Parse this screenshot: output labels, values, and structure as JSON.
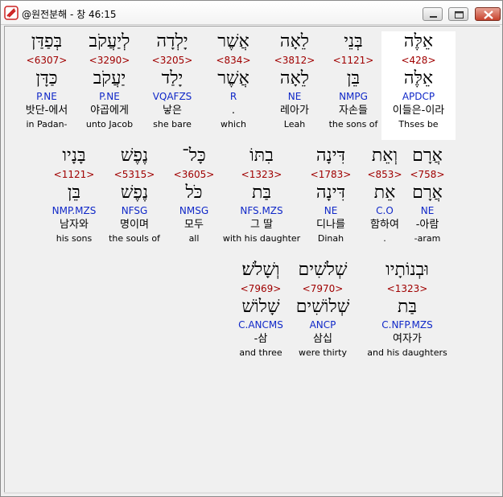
{
  "window": {
    "title": "@원전분해 - 창 46:15"
  },
  "rows": [
    {
      "words": [
        {
          "heb_pointed": "אֵלֶּה",
          "strong": "<428>",
          "lex": "אֵלֶּה",
          "parse": "APDCP",
          "korean": "이들은-이라",
          "english": "Thses be",
          "highlight": true
        },
        {
          "heb_pointed": "בְּנֵי",
          "strong": "<1121>",
          "lex": "בֵּן",
          "parse": "NMPG",
          "korean": "자손들",
          "english": "the sons of"
        },
        {
          "heb_pointed": "לֵאָה",
          "strong": "<3812>",
          "lex": "לֵאָה",
          "parse": "NE",
          "korean": "레아가",
          "english": "Leah"
        },
        {
          "heb_pointed": "אֲשֶׁר",
          "strong": "<834>",
          "lex": "אֲשֶׁר",
          "parse": "R",
          "korean": ".",
          "english": "which"
        },
        {
          "heb_pointed": "יָלְדָה",
          "strong": "<3205>",
          "lex": "יָלַד",
          "parse": "VQAFZS",
          "korean": "낳은",
          "english": "she bare"
        },
        {
          "heb_pointed": "לְיַעֲקֹב",
          "strong": "<3290>",
          "lex": "יַעֲקֹב",
          "parse": "P.NE",
          "korean": "야곱에게",
          "english": "unto Jacob"
        },
        {
          "heb_pointed": "בְּפַדַּן",
          "strong": "<6307>",
          "lex": "כַּדָּן",
          "parse": "P.NE",
          "korean": "밧단-에서",
          "english": "in Padan-"
        }
      ]
    },
    {
      "words": [
        {
          "heb_pointed": "אֲרָם",
          "strong": "<758>",
          "lex": "אֲרָם",
          "parse": "NE",
          "korean": "-아람",
          "english": "-aram"
        },
        {
          "heb_pointed": "וְאֵת",
          "strong": "<853>",
          "lex": "אֵת",
          "parse": "C.O",
          "korean": "함하여",
          "english": "."
        },
        {
          "heb_pointed": "דִּינָה",
          "strong": "<1783>",
          "lex": "דִּינָה",
          "parse": "NE",
          "korean": "디나를",
          "english": "Dinah"
        },
        {
          "heb_pointed": "בִתּוֹ",
          "strong": "<1323>",
          "lex": "בַּת",
          "parse": "NFS.MZS",
          "korean": "그 딸",
          "english": "with his daughter"
        },
        {
          "heb_pointed": "כָּל־",
          "strong": "<3605>",
          "lex": "כֹּל",
          "parse": "NMSG",
          "korean": "모두",
          "english": "all"
        },
        {
          "heb_pointed": "נֶפֶשׁ",
          "strong": "<5315>",
          "lex": "נֶפֶשׁ",
          "parse": "NFSG",
          "korean": "명이며",
          "english": "the souls of"
        },
        {
          "heb_pointed": "בָּנָיו",
          "strong": "<1121>",
          "lex": "בֵּן",
          "parse": "NMP.MZS",
          "korean": "남자와",
          "english": "his sons"
        }
      ]
    },
    {
      "words": [
        {
          "heb_pointed": "וּבְנוֹתָיו",
          "strong": "<1323>",
          "lex": "בַּת",
          "parse": "C.NFP.MZS",
          "korean": "여자가",
          "english": "and his daughters"
        },
        {
          "heb_pointed": "שְׁלֹשִׁים",
          "strong": "<7970>",
          "lex": "שְׁלוֹשִׁים",
          "parse": "ANCP",
          "korean": "삼십",
          "english": "were thirty"
        },
        {
          "heb_pointed": "וְשָׁלֹשׁ׃",
          "strong": "<7969>",
          "lex": "שָׁלוֹשׁ",
          "parse": "C.ANCMS",
          "korean": "-삼",
          "english": "and three"
        }
      ]
    }
  ],
  "colors": {
    "strong": "#a00000",
    "parse": "#1028c8",
    "highlight": "#ffffff"
  }
}
